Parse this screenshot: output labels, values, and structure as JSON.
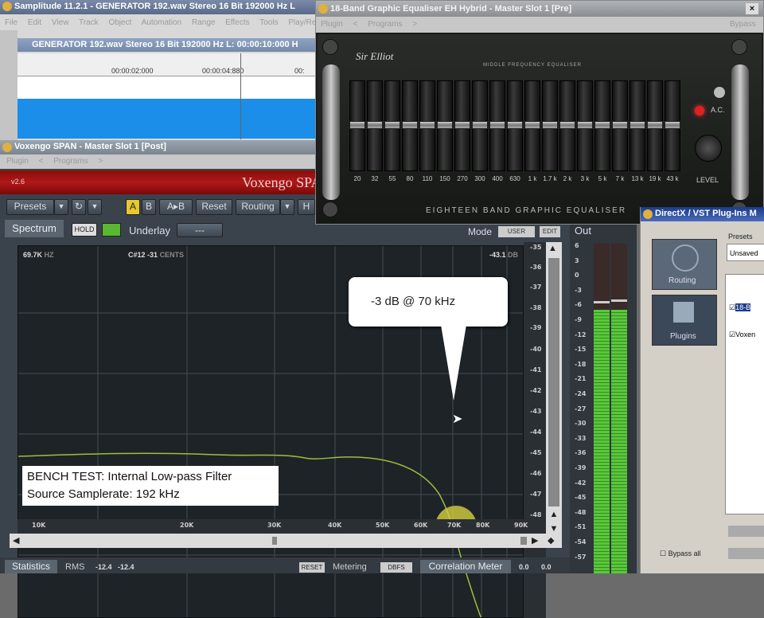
{
  "samplitude": {
    "title": "Samplitude 11.2.1 - GENERATOR 192.wav  Stereo 16 Bit 192000 Hz L",
    "menu": [
      "File",
      "Edit",
      "View",
      "Track",
      "Object",
      "Automation",
      "Range",
      "Effects",
      "Tools",
      "Play/Re"
    ],
    "wave_title": "GENERATOR 192.wav  Stereo 16 Bit 192000 Hz L: 00:00:10:000 H",
    "timeline": [
      "00:00:02:000",
      "00:00:04:880",
      "00:"
    ]
  },
  "span": {
    "title": "Voxengo SPAN - Master Slot 1 [Post]",
    "menu": [
      "Plugin",
      "<",
      "Programs",
      ">"
    ],
    "version": "v2.6",
    "brand": "Voxengo SPA",
    "toolbar": {
      "presets": "Presets",
      "a": "A",
      "b": "B",
      "ab": "A▸B",
      "reset": "Reset",
      "routing": "Routing",
      "h": "H"
    },
    "spectrum_tab": "Spectrum",
    "hold": "HOLD",
    "underlay": "Underlay",
    "underlay_value": "---",
    "mode_label": "Mode",
    "mode_value": "USER",
    "edit": "EDIT",
    "readout_freq": "69.7K",
    "readout_freq_unit": "HZ",
    "readout_note": "C#12",
    "readout_cents": "-31",
    "readout_cents_unit": "CENTS",
    "readout_db": "-43.1",
    "readout_db_unit": "DB",
    "db_ticks": [
      "-35",
      "-36",
      "-37",
      "-38",
      "-39",
      "-40",
      "-41",
      "-42",
      "-43",
      "-44",
      "-45",
      "-46",
      "-47",
      "-48"
    ],
    "freq_ticks": [
      "10K",
      "20K",
      "30K",
      "40K",
      "50K",
      "60K",
      "70K",
      "80K",
      "90K"
    ],
    "callout": "-3 dB @ 70 kHz",
    "caption_line1": "BENCH TEST: Internal Low-pass Filter",
    "caption_line2": "Source Samplerate: 192 kHz",
    "statistics_tab": "Statistics",
    "rms_label": "RMS",
    "rms_l": "-12.4",
    "rms_r": "-12.4",
    "reset": "RESET",
    "metering": "Metering",
    "dbfs": "DBFS",
    "correlation": "Correlation Meter",
    "corr_l": "0.0",
    "corr_r": "0.0",
    "out_label": "Out",
    "out_ticks": [
      "6",
      "3",
      "0",
      "-3",
      "-6",
      "-9",
      "-12",
      "-15",
      "-18",
      "-21",
      "-24",
      "-27",
      "-30",
      "-33",
      "-36",
      "-39",
      "-42",
      "-45",
      "-48",
      "-51",
      "-54",
      "-57"
    ],
    "out_level_fraction": 0.8
  },
  "eq": {
    "title": "18-Band Graphic Equaliser EH Hybrid  -  Master Slot 1 [Pre]",
    "close": "×",
    "menu": [
      "Plugin",
      "<",
      "Programs",
      ">"
    ],
    "bypass": "Bypass",
    "brand": "Sir Elliot",
    "subtitle": "MIDDLE FREQUENCY EQUALISER",
    "bands": [
      "20",
      "32",
      "55",
      "80",
      "110",
      "150",
      "270",
      "300",
      "400",
      "630",
      "1 k",
      "1.7 k",
      "2 k",
      "3 k",
      "5 k",
      "7 k",
      "13 k",
      "19 k",
      "43 k"
    ],
    "ac": "A.C.",
    "level": "LEVEL",
    "footer": "EIGHTEEN  BAND  GRAPHIC  EQUALISER"
  },
  "directx": {
    "title": "DirectX / VST Plug-Ins M",
    "presets_label": "Presets",
    "presets_value": "Unsaved",
    "routing": "Routing",
    "plugins": "Plugins",
    "item1": "18-B",
    "item2": "Voxen",
    "bypass_all": "Bypass all"
  }
}
